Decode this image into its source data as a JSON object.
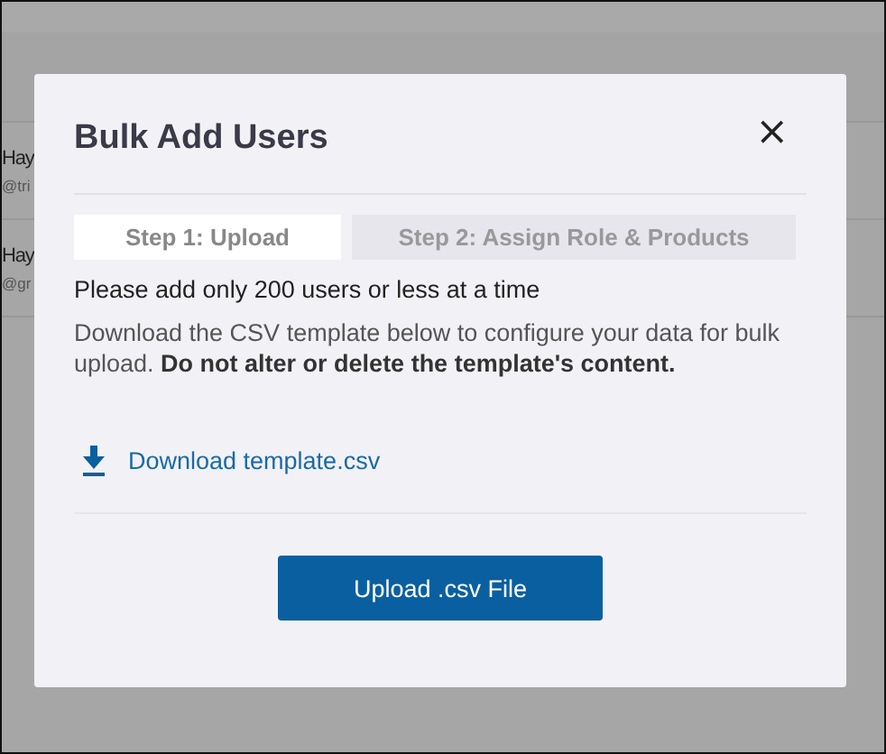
{
  "background_table": {
    "rows": [
      {
        "name": "Hay",
        "email": "@tri"
      },
      {
        "name": "Hay",
        "email": "@gr"
      }
    ]
  },
  "dialog": {
    "title": "Bulk Add Users",
    "close": "×",
    "steps": [
      {
        "label": "Step 1: Upload",
        "selected": true
      },
      {
        "label": "Step 2: Assign Role & Products",
        "selected": false
      }
    ],
    "limit_text": "Please add only 200 users or less at a time",
    "instructions": "Download the CSV template below to configure your data for bulk upload. **Do not alter or delete the template's content.**",
    "download_link": "Download template.csv",
    "upload_button": "Upload .csv File"
  }
}
